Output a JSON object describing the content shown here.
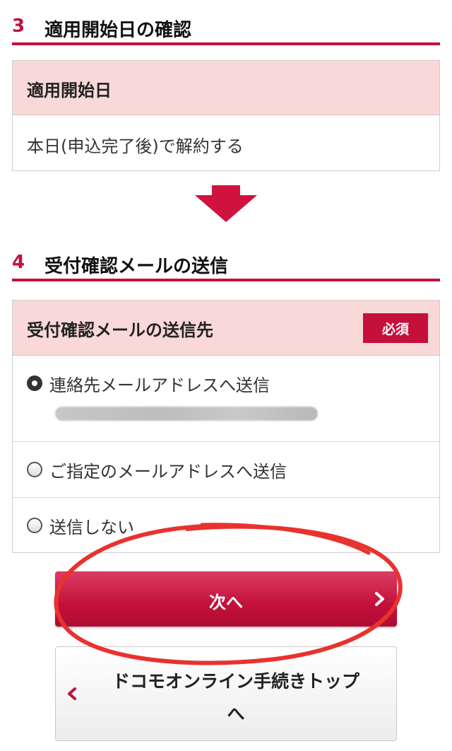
{
  "section3": {
    "number": "3",
    "title": "適用開始日の確認",
    "box_label": "適用開始日",
    "value": "本日(申込完了後)で解約する"
  },
  "section4": {
    "number": "4",
    "title": "受付確認メールの送信",
    "box_label": "受付確認メールの送信先",
    "required_badge": "必須",
    "options": [
      {
        "label": "連絡先メールアドレスへ送信",
        "selected": true
      },
      {
        "label": "ご指定のメールアドレスへ送信",
        "selected": false
      },
      {
        "label": "送信しない",
        "selected": false
      }
    ]
  },
  "buttons": {
    "next_label": "次へ",
    "top_label_line1": "ドコモオンライン手続きトップ",
    "top_label_line2": "へ"
  },
  "colors": {
    "accent": "#c4103a",
    "header_bg": "#f9d8d8",
    "annotation": "#e8322f"
  },
  "icons": {
    "arrow": "down-arrow-icon",
    "next_chevron": "chevron-right-icon",
    "back_chevron": "chevron-left-icon"
  }
}
